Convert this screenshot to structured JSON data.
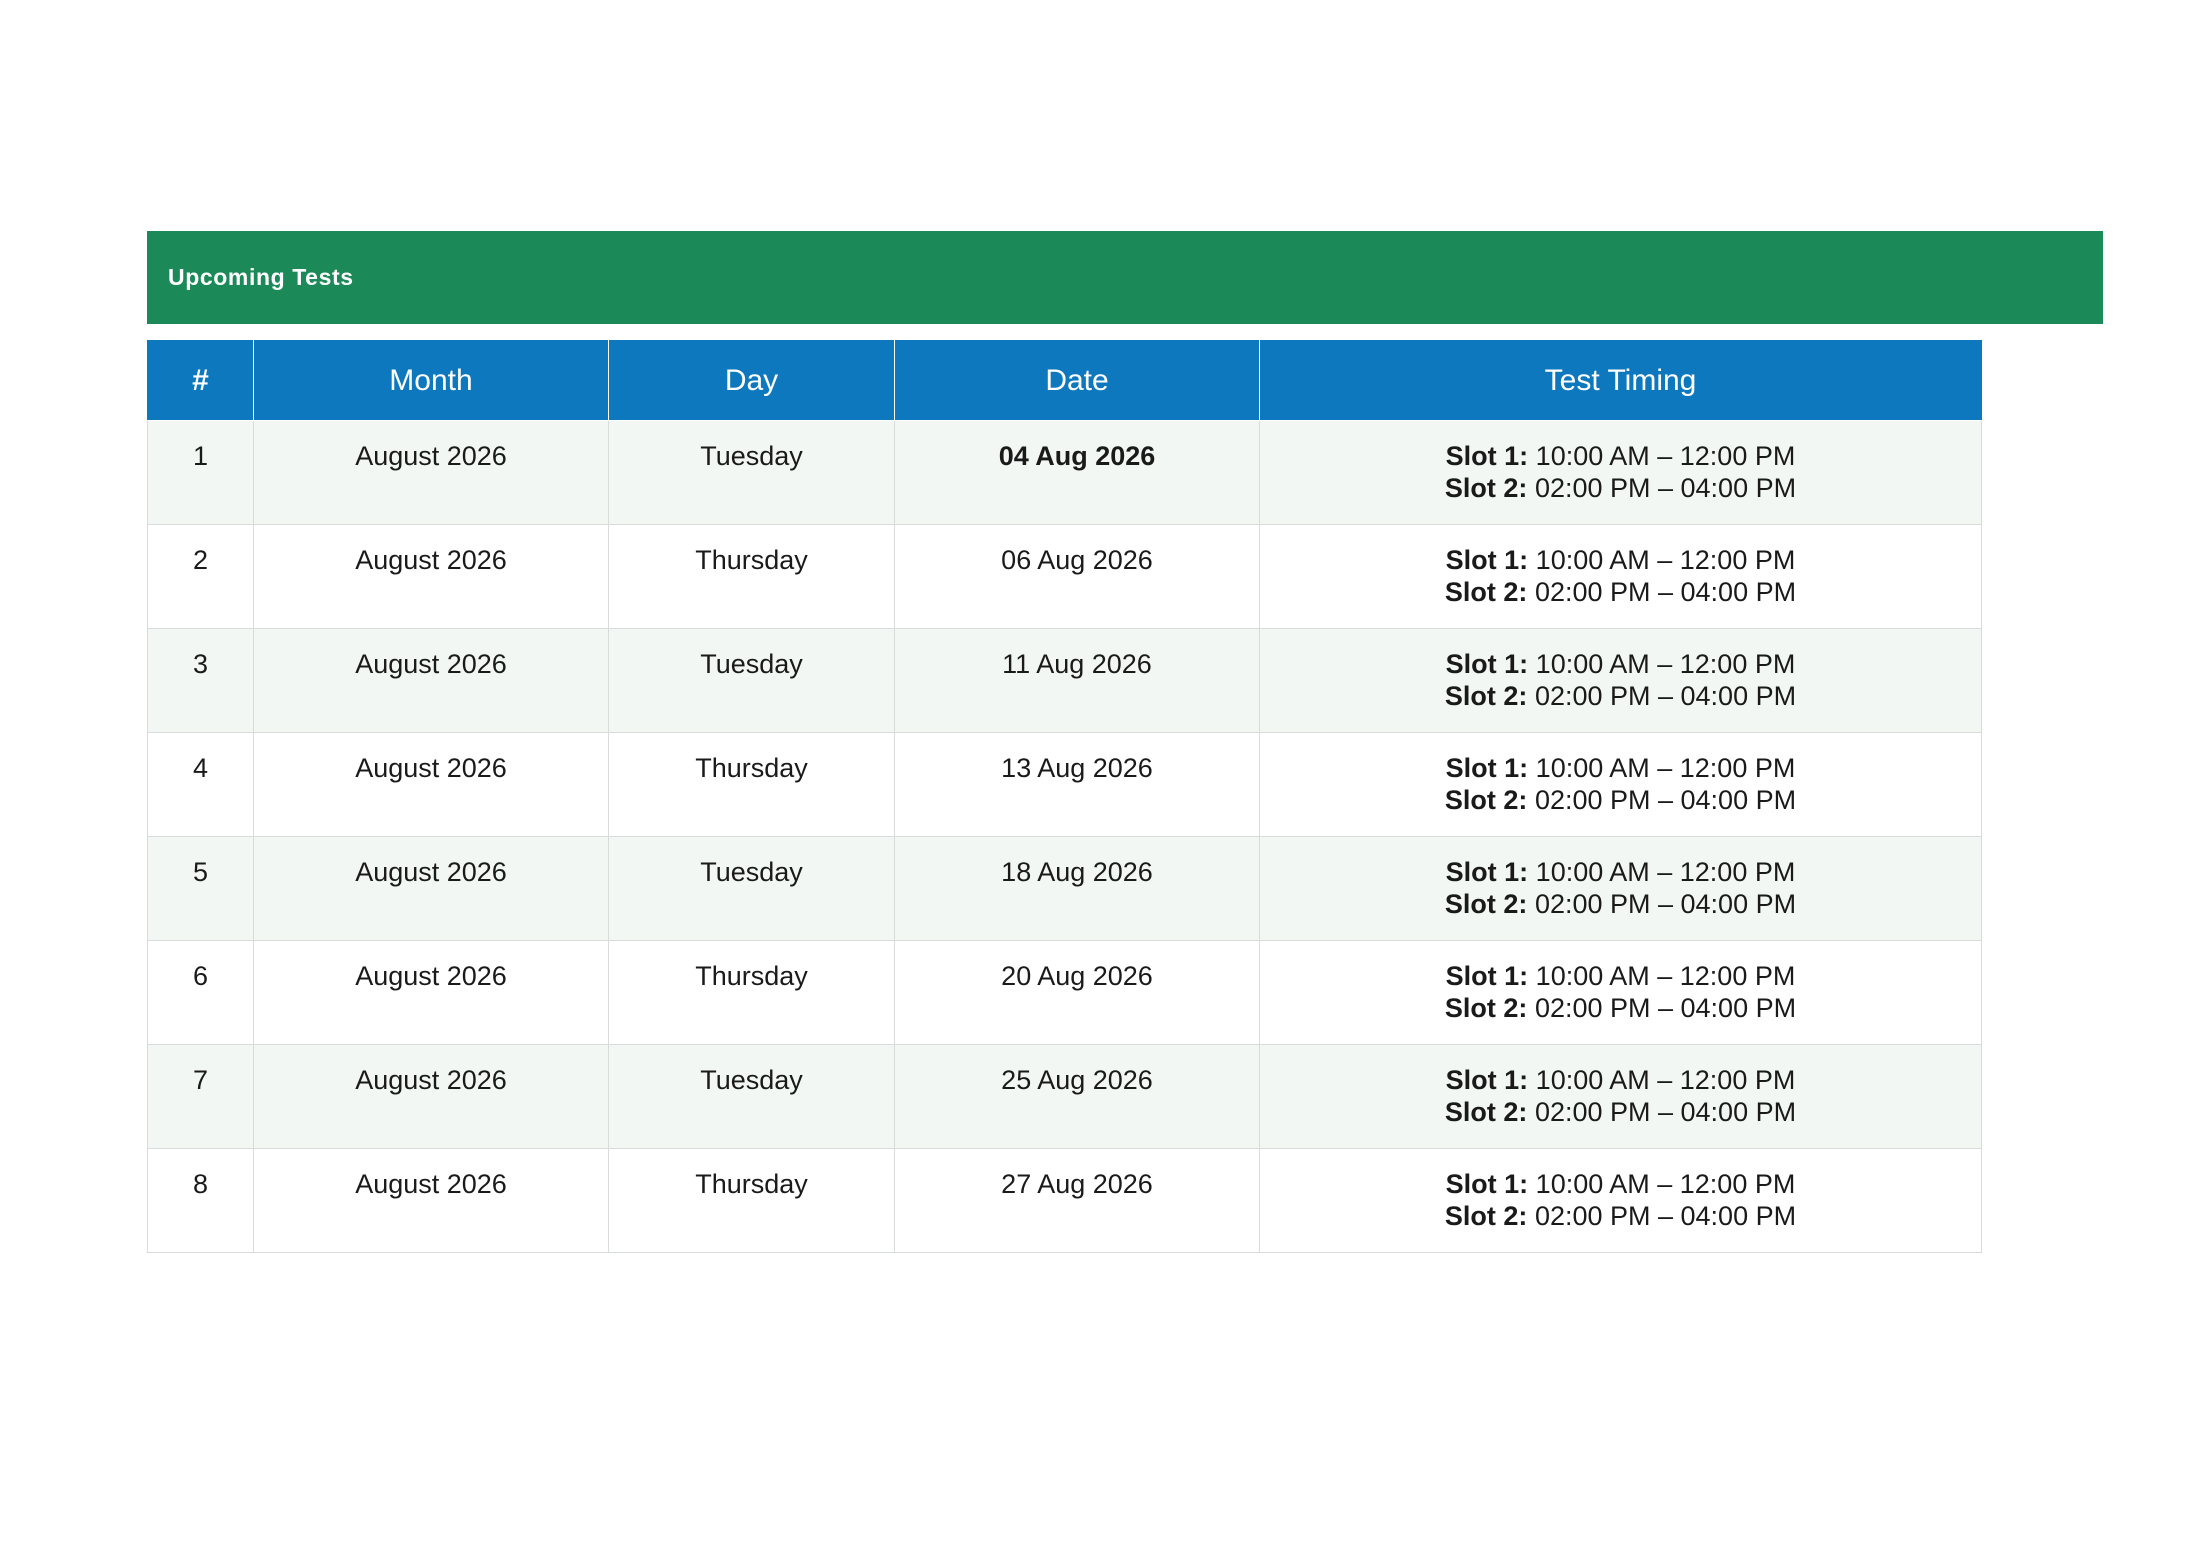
{
  "banner": {
    "title": "Upcoming Tests"
  },
  "table": {
    "headers": [
      "#",
      "Month",
      "Day",
      "Date",
      "Test Timing"
    ],
    "rows": [
      {
        "num": "1",
        "month": "August 2026",
        "day": "Tuesday",
        "date": "04 Aug 2026",
        "date_bold": true,
        "slot1_label": "Slot 1:",
        "slot1_time": "10:00 AM – 12:00 PM",
        "slot2_label": "Slot 2:",
        "slot2_time": "02:00 PM – 04:00 PM"
      },
      {
        "num": "2",
        "month": "August 2026",
        "day": "Thursday",
        "date": "06 Aug 2026",
        "date_bold": false,
        "slot1_label": "Slot 1:",
        "slot1_time": "10:00 AM – 12:00 PM",
        "slot2_label": "Slot 2:",
        "slot2_time": "02:00 PM – 04:00 PM"
      },
      {
        "num": "3",
        "month": "August 2026",
        "day": "Tuesday",
        "date": "11 Aug 2026",
        "date_bold": false,
        "slot1_label": "Slot 1:",
        "slot1_time": "10:00 AM – 12:00 PM",
        "slot2_label": "Slot 2:",
        "slot2_time": "02:00 PM – 04:00 PM"
      },
      {
        "num": "4",
        "month": "August 2026",
        "day": "Thursday",
        "date": "13 Aug 2026",
        "date_bold": false,
        "slot1_label": "Slot 1:",
        "slot1_time": "10:00 AM – 12:00 PM",
        "slot2_label": "Slot 2:",
        "slot2_time": "02:00 PM – 04:00 PM"
      },
      {
        "num": "5",
        "month": "August 2026",
        "day": "Tuesday",
        "date": "18 Aug 2026",
        "date_bold": false,
        "slot1_label": "Slot 1:",
        "slot1_time": "10:00 AM – 12:00 PM",
        "slot2_label": "Slot 2:",
        "slot2_time": "02:00 PM – 04:00 PM"
      },
      {
        "num": "6",
        "month": "August 2026",
        "day": "Thursday",
        "date": "20 Aug 2026",
        "date_bold": false,
        "slot1_label": "Slot 1:",
        "slot1_time": "10:00 AM – 12:00 PM",
        "slot2_label": "Slot 2:",
        "slot2_time": "02:00 PM – 04:00 PM"
      },
      {
        "num": "7",
        "month": "August 2026",
        "day": "Tuesday",
        "date": "25 Aug 2026",
        "date_bold": false,
        "slot1_label": "Slot 1:",
        "slot1_time": "10:00 AM – 12:00 PM",
        "slot2_label": "Slot 2:",
        "slot2_time": "02:00 PM – 04:00 PM"
      },
      {
        "num": "8",
        "month": "August 2026",
        "day": "Thursday",
        "date": "27 Aug 2026",
        "date_bold": false,
        "slot1_label": "Slot 1:",
        "slot1_time": "10:00 AM – 12:00 PM",
        "slot2_label": "Slot 2:",
        "slot2_time": "02:00 PM – 04:00 PM"
      }
    ]
  },
  "colors": {
    "banner_green": "#1b8a58",
    "header_blue": "#0e78bf",
    "row_tint": "#f2f7f4",
    "grid_line": "#d7dbdb"
  }
}
